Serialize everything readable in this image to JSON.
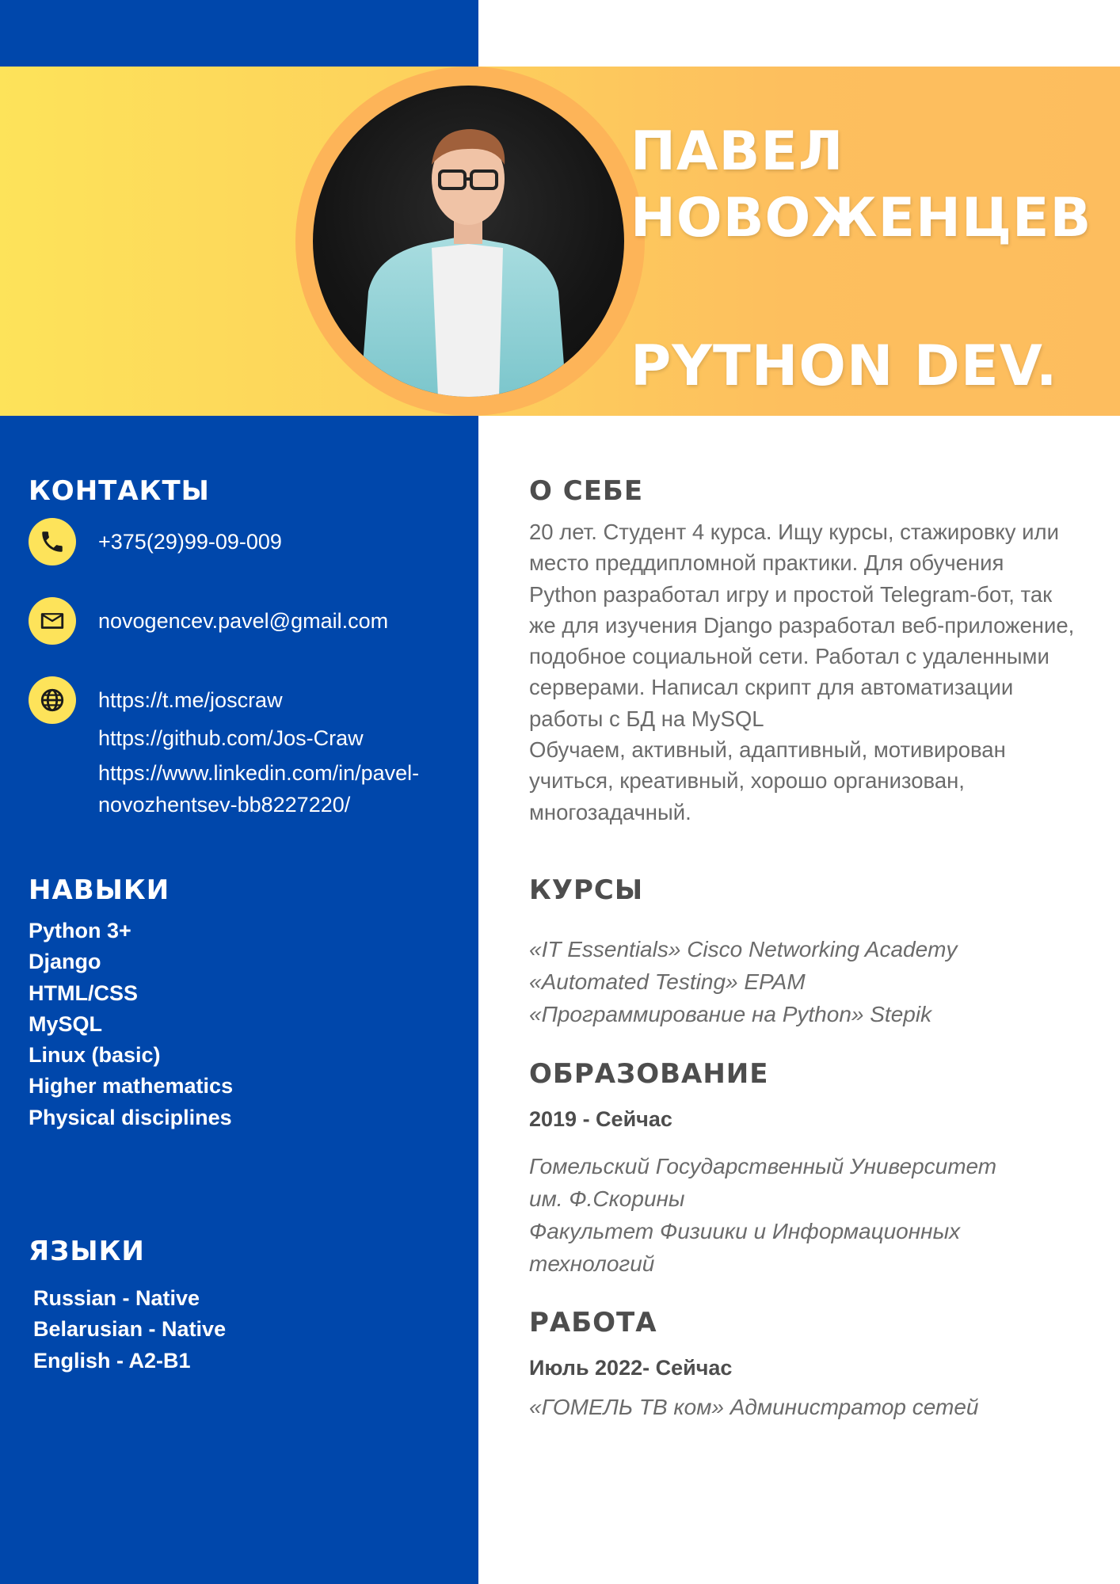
{
  "header": {
    "name_line1": "ПАВЕЛ",
    "name_line2": "НОВОЖЕНЦЕВ",
    "role": "PYTHON DEV."
  },
  "contacts": {
    "heading": "КОНТАКТЫ",
    "phone": "+375(29)99-09-009",
    "email": "novogencev.pavel@gmail.com",
    "links": [
      "https://t.me/joscraw",
      "https://github.com/Jos-Craw",
      "https://www.linkedin.com/in/pavel-novozhentsev-bb8227220/"
    ],
    "icons": [
      "phone-icon",
      "mail-icon",
      "globe-icon"
    ]
  },
  "skills": {
    "heading": "НАВЫКИ",
    "items": [
      "Python 3+",
      "Django",
      "HTML/CSS",
      "MySQL",
      "Linux (basic)",
      "Higher mathematics",
      "Physical disciplines"
    ]
  },
  "languages": {
    "heading": "ЯЗЫКИ",
    "items": [
      "Russian - Native",
      "Belarusian - Native",
      "English - A2-B1"
    ]
  },
  "about": {
    "heading": "О СЕБЕ",
    "text": "20 лет. Студент 4 курса. Ищу курсы, стажировку или место преддипломной практики. Для обучения Python разработал игру и простой Telegram-бот, так же для изучения Django разработал веб-приложение, подобное социальной сети. Работал с удаленными серверами. Написал скрипт для автоматизации работы с БД на MySQL",
    "traits": "Обучаем, активный, адаптивный, мотивирован учиться, креативный, хорошо организован, многозадачный."
  },
  "courses": {
    "heading": "КУРСЫ",
    "items": [
      "«IT Essentials» Cisco Networking Academy",
      "«Automated Testing» EPAM",
      "«Программирование на Python» Stepik"
    ]
  },
  "education": {
    "heading": "ОБРАЗОВАНИЕ",
    "period": "2019 - Сейчас",
    "lines": [
      "Гомельский Государственный Университет",
      "им. Ф.Скорины",
      "Факультет Физиики и Информационных",
      "технологий"
    ]
  },
  "work": {
    "heading": "РАБОТА",
    "period": "Июль 2022- Сейчас",
    "position": "«ГОМЕЛЬ ТВ ком» Администратор сетей"
  },
  "colors": {
    "left_column": "#0047ab",
    "banner_yellow": "#fde35a",
    "banner_orange": "#fdbd5e",
    "icon_circle": "#fde35a",
    "heading_gray": "#4d4d4d",
    "text_gray": "#6b6b6b"
  }
}
